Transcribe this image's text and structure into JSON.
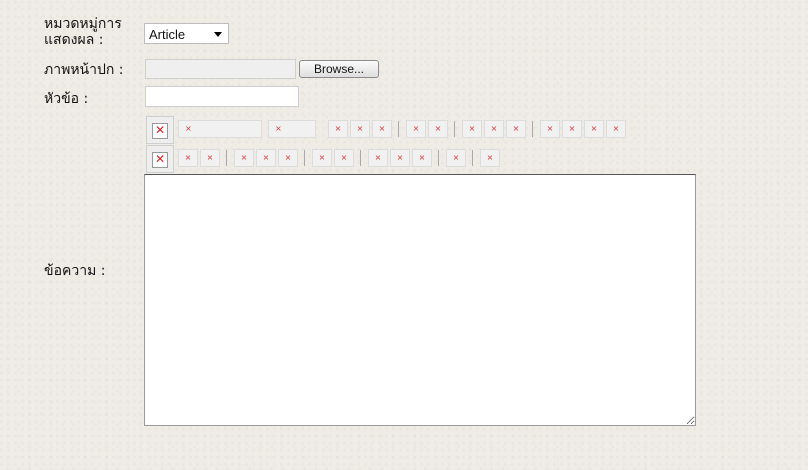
{
  "form": {
    "category_label": "หมวดหมู่การแสดงผล :",
    "category_value": "Article",
    "cover_label": "ภาพหน้าปก :",
    "browse_label": "Browse...",
    "title_label": "หัวข้อ :",
    "title_value": "",
    "content_label": "ข้อความ :",
    "content_value": ""
  },
  "toolbar": {
    "broken_icon_glyph": "×",
    "big_icon_glyph": "✕"
  }
}
